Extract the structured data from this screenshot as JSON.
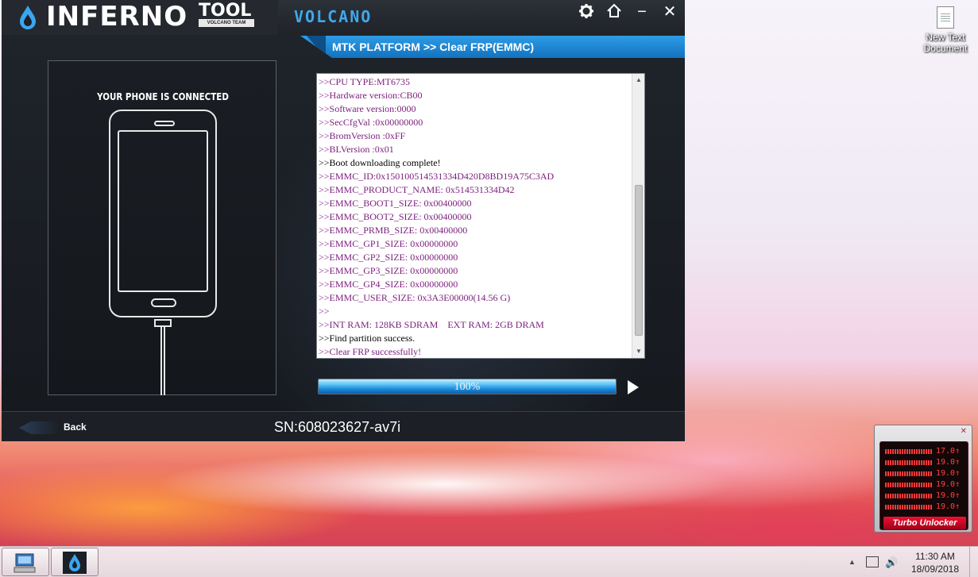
{
  "desktop": {
    "icon_label": "New Text Document"
  },
  "app": {
    "logo": {
      "inferno": "INFERNO",
      "tool": "TOOL",
      "team": "VOLCANO TEAM"
    },
    "name": "VOLCANO",
    "title_controls": {
      "settings_icon": "gear-icon",
      "home_icon": "home-icon",
      "minimize": "−",
      "close": "✕"
    },
    "platform_path": "MTK PLATFORM >> Clear FRP(EMMC)",
    "phone_status": "YOUR PHONE IS CONNECTED",
    "log_lines": [
      ">>CPU TYPE:MT6735",
      ">>Hardware version:CB00",
      ">>Software version:0000",
      ">>SecCfgVal :0x00000000",
      ">>BromVersion :0xFF",
      ">>BLVersion :0x01",
      ">>Boot downloading complete!",
      ">>EMMC_ID:0x150100514531334D420D8BD19A75C3AD",
      ">>EMMC_PRODUCT_NAME: 0x514531334D42",
      ">>EMMC_BOOT1_SIZE: 0x00400000",
      ">>EMMC_BOOT2_SIZE: 0x00400000",
      ">>EMMC_PRMB_SIZE: 0x00400000",
      ">>EMMC_GP1_SIZE: 0x00000000",
      ">>EMMC_GP2_SIZE: 0x00000000",
      ">>EMMC_GP3_SIZE: 0x00000000",
      ">>EMMC_GP4_SIZE: 0x00000000",
      ">>EMMC_USER_SIZE: 0x3A3E00000(14.56 G)",
      ">>",
      ">>INT RAM: 128KB SDRAM    EXT RAM: 2GB DRAM",
      ">>Find partition success.",
      ">>Clear FRP successfully!"
    ],
    "log_black_lines": [
      6,
      19
    ],
    "progress": {
      "percent": 100,
      "label": "100%"
    },
    "back_label": "Back",
    "serial": "SN:608023627-av7i"
  },
  "turbo": {
    "rows": [
      "17.0↑",
      "19.0↑",
      "19.0↑",
      "19.0↑",
      "19.0↑",
      "19.0↑"
    ],
    "name": "Turbo Unlocker",
    "close": "✕"
  },
  "taskbar": {
    "time": "11:30 AM",
    "date": "18/09/2018",
    "tray_up": "▲",
    "tray_volume": "🔊"
  },
  "colors": {
    "accent_blue": "#2f9ce6",
    "log_text": "#7b1d7b",
    "turbo_red": "#ff4141"
  }
}
